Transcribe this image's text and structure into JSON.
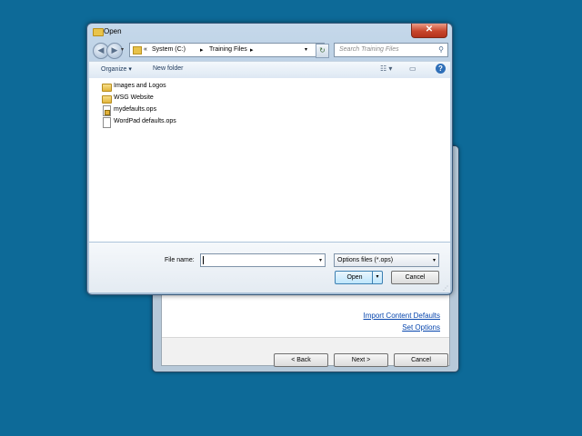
{
  "dialog": {
    "title": "Open",
    "close_glyph": "✕",
    "address": {
      "root_glyph": "«",
      "segments": [
        "System (C:)",
        "Training Files"
      ],
      "separator": "▸"
    },
    "search_placeholder": "Search Training Files",
    "toolbar": {
      "organize": "Organize ▾",
      "new_folder": "New folder"
    },
    "files": [
      {
        "name": "Images and Logos",
        "icon": "folder-icon"
      },
      {
        "name": "WSG Website",
        "icon": "folder-icon"
      },
      {
        "name": "mydefaults.ops",
        "icon": "ops-file-icon"
      },
      {
        "name": "WordPad defaults.ops",
        "icon": "document-icon"
      }
    ],
    "file_name_label": "File name:",
    "file_name_value": "",
    "file_type": "Options files (*.ops)",
    "open_label": "Open",
    "cancel_label": "Cancel"
  },
  "wizard": {
    "links": [
      "Import Content Defaults",
      "Set Options"
    ],
    "back_label": "< Back",
    "next_label": "Next >",
    "cancel_label": "Cancel"
  },
  "colors": {
    "desktop": "#0d6a98",
    "link": "#0645ad",
    "close": "#c8462c"
  }
}
